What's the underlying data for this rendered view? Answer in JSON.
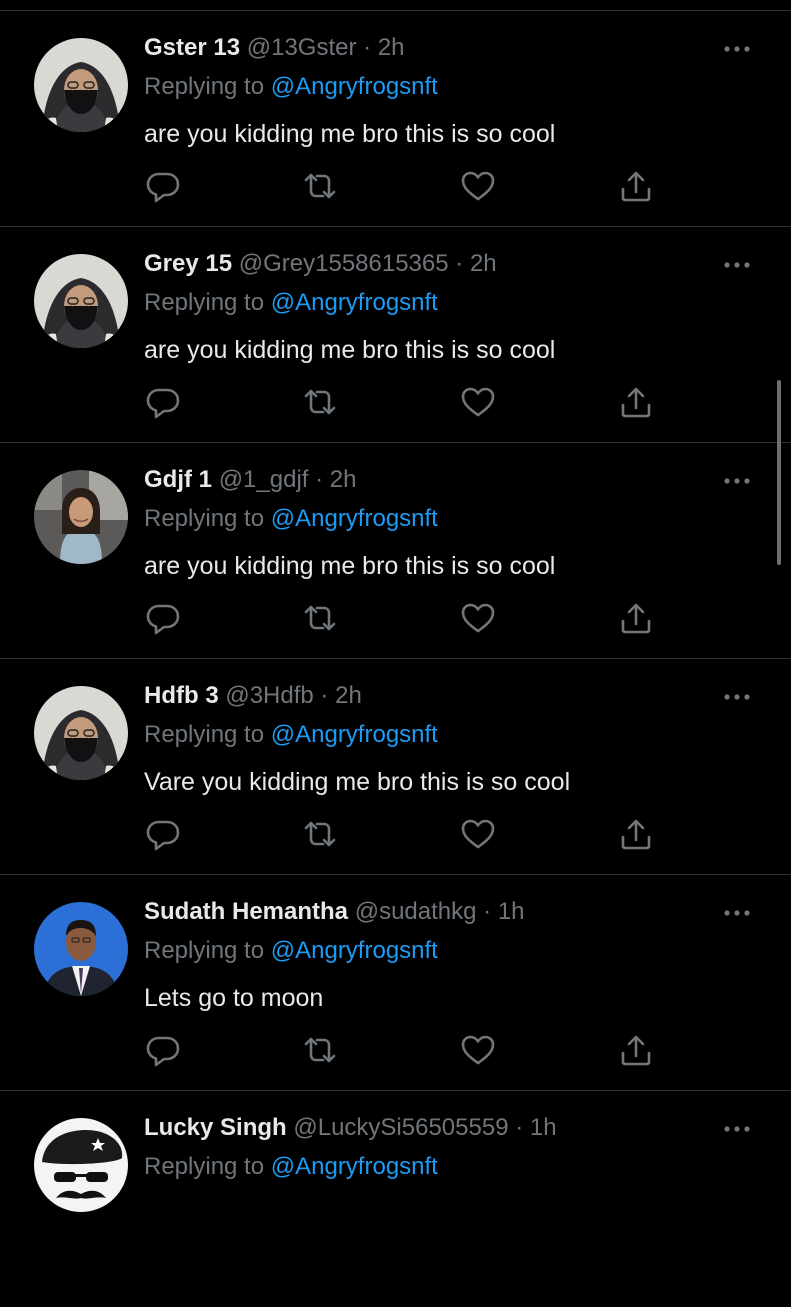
{
  "reply_prefix": "Replying to ",
  "tweets": [
    {
      "name": "Gster 13",
      "handle": "@13Gster",
      "separator": "·",
      "time": "2h",
      "mention": "@Angryfrogsnft",
      "text": "are you kidding me bro this is so cool",
      "avatar": "hijab-masked-user"
    },
    {
      "name": "Grey 15",
      "handle": "@Grey1558615365",
      "separator": "·",
      "time": "2h",
      "mention": "@Angryfrogsnft",
      "text": "are you kidding me bro this is so cool",
      "avatar": "hijab-masked-user"
    },
    {
      "name": "Gdjf 1",
      "handle": "@1_gdjf",
      "separator": "·",
      "time": "2h",
      "mention": "@Angryfrogsnft",
      "text": "are you kidding me bro this is so cool",
      "avatar": "woman-in-car"
    },
    {
      "name": "Hdfb 3",
      "handle": "@3Hdfb",
      "separator": "·",
      "time": "2h",
      "mention": "@Angryfrogsnft",
      "text": "Vare you kidding me bro this is so cool",
      "avatar": "hijab-masked-user"
    },
    {
      "name": "Sudath Hemantha",
      "handle": "@sudathkg",
      "separator": "·",
      "time": "1h",
      "mention": "@Angryfrogsnft",
      "text": "Lets go to moon",
      "avatar": "man-in-suit"
    },
    {
      "name": "Lucky Singh",
      "handle": "@LuckySi56505559",
      "separator": "·",
      "time": "1h",
      "mention": "@Angryfrogsnft",
      "text": "",
      "avatar": "beret-mustache-cartoon"
    }
  ],
  "icons": {
    "more": "more-horizontal-icon",
    "reply": "reply-icon",
    "retweet": "retweet-icon",
    "like": "heart-icon",
    "share": "share-icon"
  },
  "colors": {
    "background": "#000000",
    "text": "#e7e9ea",
    "secondary": "#71767b",
    "link": "#1d9bf0",
    "divider": "#2f3336"
  }
}
